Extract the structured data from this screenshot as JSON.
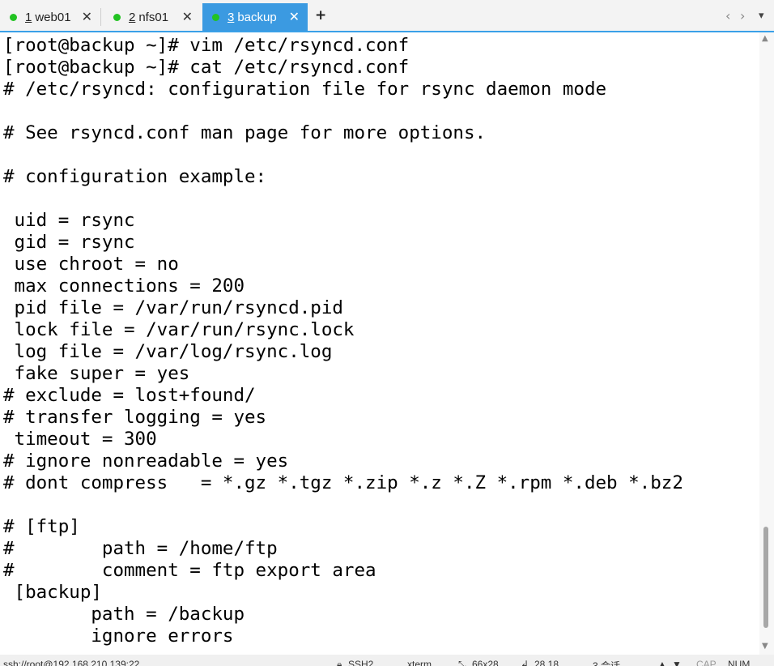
{
  "tabs": [
    {
      "number": "1",
      "label": "web01",
      "active": false
    },
    {
      "number": "2",
      "label": "nfs01",
      "active": false
    },
    {
      "number": "3",
      "label": "backup",
      "active": true
    }
  ],
  "tab_close_glyph": "✕",
  "new_tab_glyph": "+",
  "nav": {
    "prev": "‹",
    "next": "›",
    "menu": "▾"
  },
  "terminal": {
    "lines": [
      "[root@backup ~]# vim /etc/rsyncd.conf",
      "[root@backup ~]# cat /etc/rsyncd.conf",
      "# /etc/rsyncd: configuration file for rsync daemon mode",
      "",
      "# See rsyncd.conf man page for more options.",
      "",
      "# configuration example:",
      "",
      " uid = rsync",
      " gid = rsync",
      " use chroot = no",
      " max connections = 200",
      " pid file = /var/run/rsyncd.pid",
      " lock file = /var/run/rsync.lock",
      " log file = /var/log/rsync.log",
      " fake super = yes",
      "# exclude = lost+found/",
      "# transfer logging = yes",
      " timeout = 300",
      "# ignore nonreadable = yes",
      "# dont compress   = *.gz *.tgz *.zip *.z *.Z *.rpm *.deb *.bz2",
      "",
      "# [ftp]",
      "#        path = /home/ftp",
      "#        comment = ftp export area",
      " [backup]",
      "        path = /backup",
      "        ignore errors"
    ]
  },
  "scroll": {
    "thumb_start": 0.81,
    "thumb_end": 0.98
  },
  "status": {
    "session": "ssh://root@192.168.210.139:22",
    "protocol": "SSH2",
    "terminal_type": "xterm",
    "size": "66x28",
    "cursor": "28,18",
    "sessions": "3 会话",
    "caps": "CAP",
    "num": "NUM"
  },
  "colors": {
    "accent": "#3b9ae1",
    "online_dot": "#22c322"
  }
}
